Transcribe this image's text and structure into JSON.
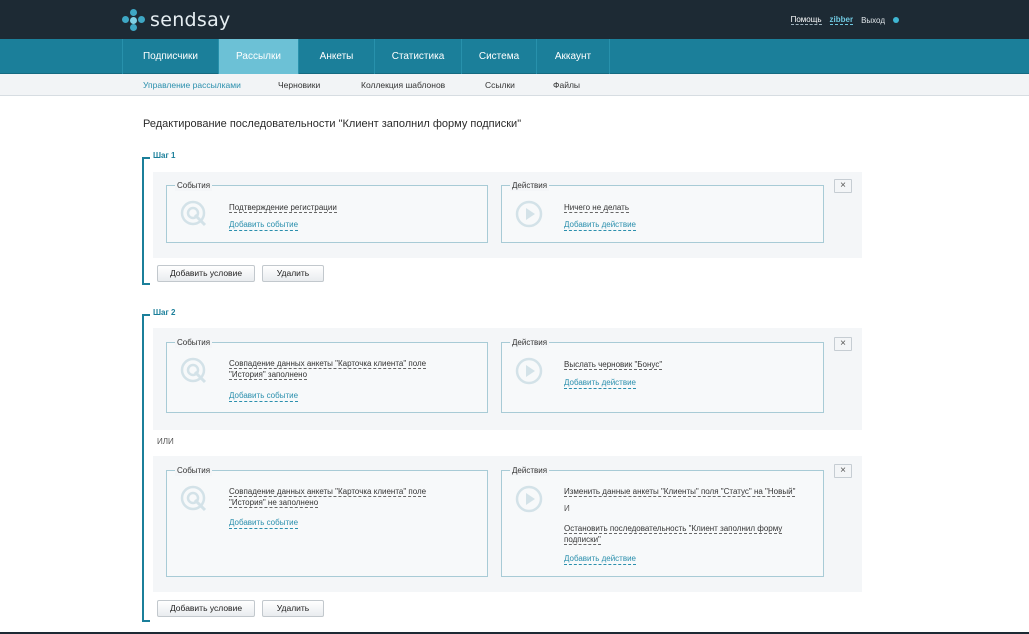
{
  "header": {
    "logo_text": "sendsay",
    "help_link": "Помощь",
    "user_name": "zibber",
    "logout": "Выход",
    "brand_color": "#1b7f9a"
  },
  "main_nav": {
    "tabs": [
      {
        "label": "Подписчики"
      },
      {
        "label": "Рассылки",
        "active": true
      },
      {
        "label": "Анкеты"
      },
      {
        "label": "Статистика"
      },
      {
        "label": "Система"
      },
      {
        "label": "Аккаунт"
      }
    ]
  },
  "sub_nav": {
    "items": [
      {
        "label": "Управление рассылками",
        "active": true
      },
      {
        "label": "Черновики"
      },
      {
        "label": "Коллекция шаблонов"
      },
      {
        "label": "Ссылки"
      },
      {
        "label": "Файлы"
      }
    ]
  },
  "page_title": "Редактирование последовательности \"Клиент заполнил форму подписки\"",
  "steps": [
    {
      "label": "Шаг 1",
      "rules": [
        {
          "events_legend": "События",
          "event_lines": [
            "Подтверждение регистрации"
          ],
          "add_event": "Добавить событие",
          "actions_legend": "Действия",
          "action_lines": [
            "Ничего не делать"
          ],
          "add_action": "Добавить действие",
          "close": "×"
        }
      ],
      "add_condition": "Добавить условие",
      "delete": "Удалить"
    },
    {
      "label": "Шаг 2",
      "or_label": "ИЛИ",
      "rules": [
        {
          "events_legend": "События",
          "event_lines": [
            "Совпадение данных анкеты \"Карточка клиента\" поле",
            "\"История\" заполнено"
          ],
          "add_event": "Добавить событие",
          "actions_legend": "Действия",
          "action_lines": [
            "Выслать черновик \"Бонус\""
          ],
          "add_action": "Добавить действие",
          "close": "×"
        },
        {
          "events_legend": "События",
          "event_lines": [
            "Совпадение данных анкеты \"Карточка клиента\" поле",
            "\"История\" не заполнено"
          ],
          "add_event": "Добавить событие",
          "actions_legend": "Действия",
          "action_lines_a": [
            "Изменить данные анкеты \"Клиенты\" поля \"Статус\" на \"Новый\""
          ],
          "and_label": "И",
          "action_lines_b": [
            "Остановить последовательность \"Клиент заполнил форму",
            "подписки\""
          ],
          "add_action": "Добавить действие",
          "close": "×"
        }
      ],
      "add_condition": "Добавить условие",
      "delete": "Удалить"
    }
  ]
}
